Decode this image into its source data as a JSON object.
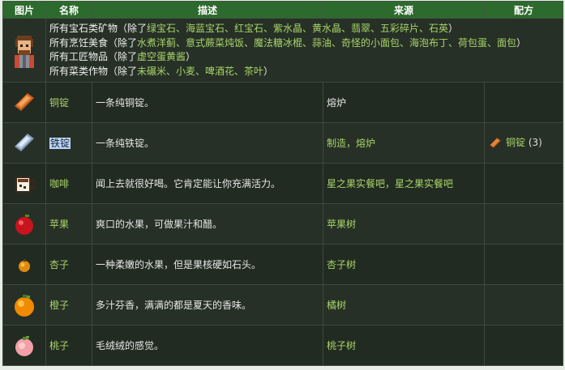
{
  "table": {
    "headers": {
      "image": "图片",
      "name": "名称",
      "desc": "描述",
      "source": "来源",
      "recipe": "配方"
    },
    "friend_row": {
      "lines": [
        {
          "prefix": "所有宝石类矿物（除了",
          "items": "绿宝石、海蓝宝石、红宝石、紫水晶、黄水晶、翡翠、五彩碎片、石英",
          "suffix": "）"
        },
        {
          "prefix": "所有烹饪美食（除了",
          "items": "水煮洋蓟、意式蕨菜炖饭、魔法糖冰棍、蒜油、奇怪的小面包、海泡布丁、荷包蛋、面包",
          "suffix": "）"
        },
        {
          "prefix": "所有工匠物品（除了",
          "items": "虚空蛋黄酱",
          "suffix": "）"
        },
        {
          "prefix": "所有菜类作物（除了",
          "items": "未碾米、小麦、啤酒花、茶叶",
          "suffix": "）"
        }
      ]
    },
    "rows": [
      {
        "name": "铜锭",
        "desc": "一条纯铜锭。",
        "source": "熔炉",
        "recipe": "",
        "icon": "copper-bar-icon"
      },
      {
        "name": "铁锭",
        "desc": "一条纯铁锭。",
        "source": "制造，熔炉",
        "recipe_item": "铜锭",
        "recipe_count": "(3)",
        "icon": "iron-bar-icon"
      },
      {
        "name": "咖啡",
        "desc": "闻上去就很好喝。它肯定能让你充满活力。",
        "source": "星之果实餐吧，星之果实餐吧",
        "recipe": "",
        "icon": "coffee-icon"
      },
      {
        "name": "苹果",
        "desc": "爽口的水果，可做果汁和醋。",
        "source": "苹果树",
        "recipe": "",
        "icon": "apple-icon"
      },
      {
        "name": "杏子",
        "desc": "一种柔嫩的水果，但是果核硬如石头。",
        "source": "杏子树",
        "recipe": "",
        "icon": "apricot-icon"
      },
      {
        "name": "橙子",
        "desc": "多汁芬香，满满的都是夏天的香味。",
        "source": "橘树",
        "recipe": "",
        "icon": "orange-icon"
      },
      {
        "name": "桃子",
        "desc": "毛绒绒的感觉。",
        "source": "桃子树",
        "recipe": "",
        "icon": "peach-icon"
      }
    ]
  },
  "colors": {
    "header_bg": "#2d6a2d",
    "row_bg": "#263026",
    "link_green": "#a9d36a",
    "selection": "#b9d7ff"
  }
}
